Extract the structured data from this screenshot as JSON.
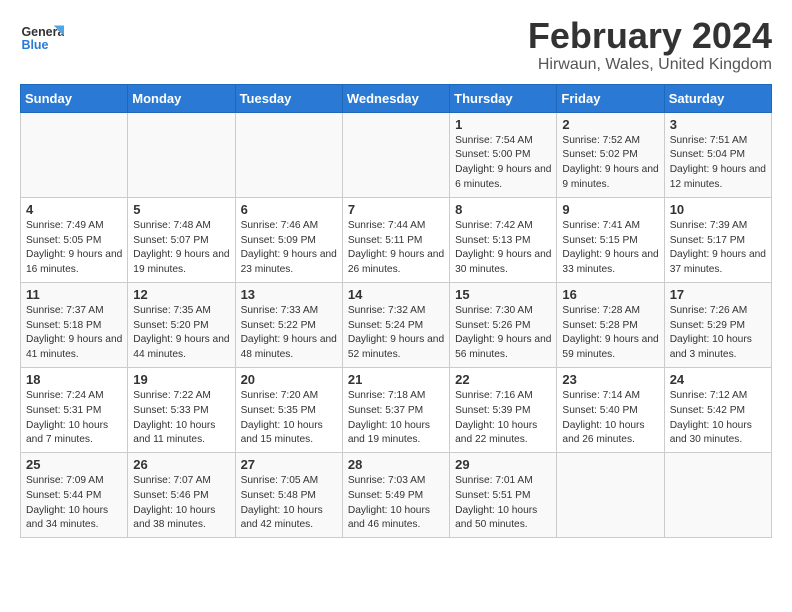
{
  "header": {
    "title": "February 2024",
    "subtitle": "Hirwaun, Wales, United Kingdom"
  },
  "logo": {
    "line1": "General",
    "line2": "Blue"
  },
  "days_of_week": [
    "Sunday",
    "Monday",
    "Tuesday",
    "Wednesday",
    "Thursday",
    "Friday",
    "Saturday"
  ],
  "weeks": [
    [
      {
        "date": "",
        "content": ""
      },
      {
        "date": "",
        "content": ""
      },
      {
        "date": "",
        "content": ""
      },
      {
        "date": "",
        "content": ""
      },
      {
        "date": "1",
        "content": "Sunrise: 7:54 AM\nSunset: 5:00 PM\nDaylight: 9 hours and 6 minutes."
      },
      {
        "date": "2",
        "content": "Sunrise: 7:52 AM\nSunset: 5:02 PM\nDaylight: 9 hours and 9 minutes."
      },
      {
        "date": "3",
        "content": "Sunrise: 7:51 AM\nSunset: 5:04 PM\nDaylight: 9 hours and 12 minutes."
      }
    ],
    [
      {
        "date": "4",
        "content": "Sunrise: 7:49 AM\nSunset: 5:05 PM\nDaylight: 9 hours and 16 minutes."
      },
      {
        "date": "5",
        "content": "Sunrise: 7:48 AM\nSunset: 5:07 PM\nDaylight: 9 hours and 19 minutes."
      },
      {
        "date": "6",
        "content": "Sunrise: 7:46 AM\nSunset: 5:09 PM\nDaylight: 9 hours and 23 minutes."
      },
      {
        "date": "7",
        "content": "Sunrise: 7:44 AM\nSunset: 5:11 PM\nDaylight: 9 hours and 26 minutes."
      },
      {
        "date": "8",
        "content": "Sunrise: 7:42 AM\nSunset: 5:13 PM\nDaylight: 9 hours and 30 minutes."
      },
      {
        "date": "9",
        "content": "Sunrise: 7:41 AM\nSunset: 5:15 PM\nDaylight: 9 hours and 33 minutes."
      },
      {
        "date": "10",
        "content": "Sunrise: 7:39 AM\nSunset: 5:17 PM\nDaylight: 9 hours and 37 minutes."
      }
    ],
    [
      {
        "date": "11",
        "content": "Sunrise: 7:37 AM\nSunset: 5:18 PM\nDaylight: 9 hours and 41 minutes."
      },
      {
        "date": "12",
        "content": "Sunrise: 7:35 AM\nSunset: 5:20 PM\nDaylight: 9 hours and 44 minutes."
      },
      {
        "date": "13",
        "content": "Sunrise: 7:33 AM\nSunset: 5:22 PM\nDaylight: 9 hours and 48 minutes."
      },
      {
        "date": "14",
        "content": "Sunrise: 7:32 AM\nSunset: 5:24 PM\nDaylight: 9 hours and 52 minutes."
      },
      {
        "date": "15",
        "content": "Sunrise: 7:30 AM\nSunset: 5:26 PM\nDaylight: 9 hours and 56 minutes."
      },
      {
        "date": "16",
        "content": "Sunrise: 7:28 AM\nSunset: 5:28 PM\nDaylight: 9 hours and 59 minutes."
      },
      {
        "date": "17",
        "content": "Sunrise: 7:26 AM\nSunset: 5:29 PM\nDaylight: 10 hours and 3 minutes."
      }
    ],
    [
      {
        "date": "18",
        "content": "Sunrise: 7:24 AM\nSunset: 5:31 PM\nDaylight: 10 hours and 7 minutes."
      },
      {
        "date": "19",
        "content": "Sunrise: 7:22 AM\nSunset: 5:33 PM\nDaylight: 10 hours and 11 minutes."
      },
      {
        "date": "20",
        "content": "Sunrise: 7:20 AM\nSunset: 5:35 PM\nDaylight: 10 hours and 15 minutes."
      },
      {
        "date": "21",
        "content": "Sunrise: 7:18 AM\nSunset: 5:37 PM\nDaylight: 10 hours and 19 minutes."
      },
      {
        "date": "22",
        "content": "Sunrise: 7:16 AM\nSunset: 5:39 PM\nDaylight: 10 hours and 22 minutes."
      },
      {
        "date": "23",
        "content": "Sunrise: 7:14 AM\nSunset: 5:40 PM\nDaylight: 10 hours and 26 minutes."
      },
      {
        "date": "24",
        "content": "Sunrise: 7:12 AM\nSunset: 5:42 PM\nDaylight: 10 hours and 30 minutes."
      }
    ],
    [
      {
        "date": "25",
        "content": "Sunrise: 7:09 AM\nSunset: 5:44 PM\nDaylight: 10 hours and 34 minutes."
      },
      {
        "date": "26",
        "content": "Sunrise: 7:07 AM\nSunset: 5:46 PM\nDaylight: 10 hours and 38 minutes."
      },
      {
        "date": "27",
        "content": "Sunrise: 7:05 AM\nSunset: 5:48 PM\nDaylight: 10 hours and 42 minutes."
      },
      {
        "date": "28",
        "content": "Sunrise: 7:03 AM\nSunset: 5:49 PM\nDaylight: 10 hours and 46 minutes."
      },
      {
        "date": "29",
        "content": "Sunrise: 7:01 AM\nSunset: 5:51 PM\nDaylight: 10 hours and 50 minutes."
      },
      {
        "date": "",
        "content": ""
      },
      {
        "date": "",
        "content": ""
      }
    ]
  ]
}
